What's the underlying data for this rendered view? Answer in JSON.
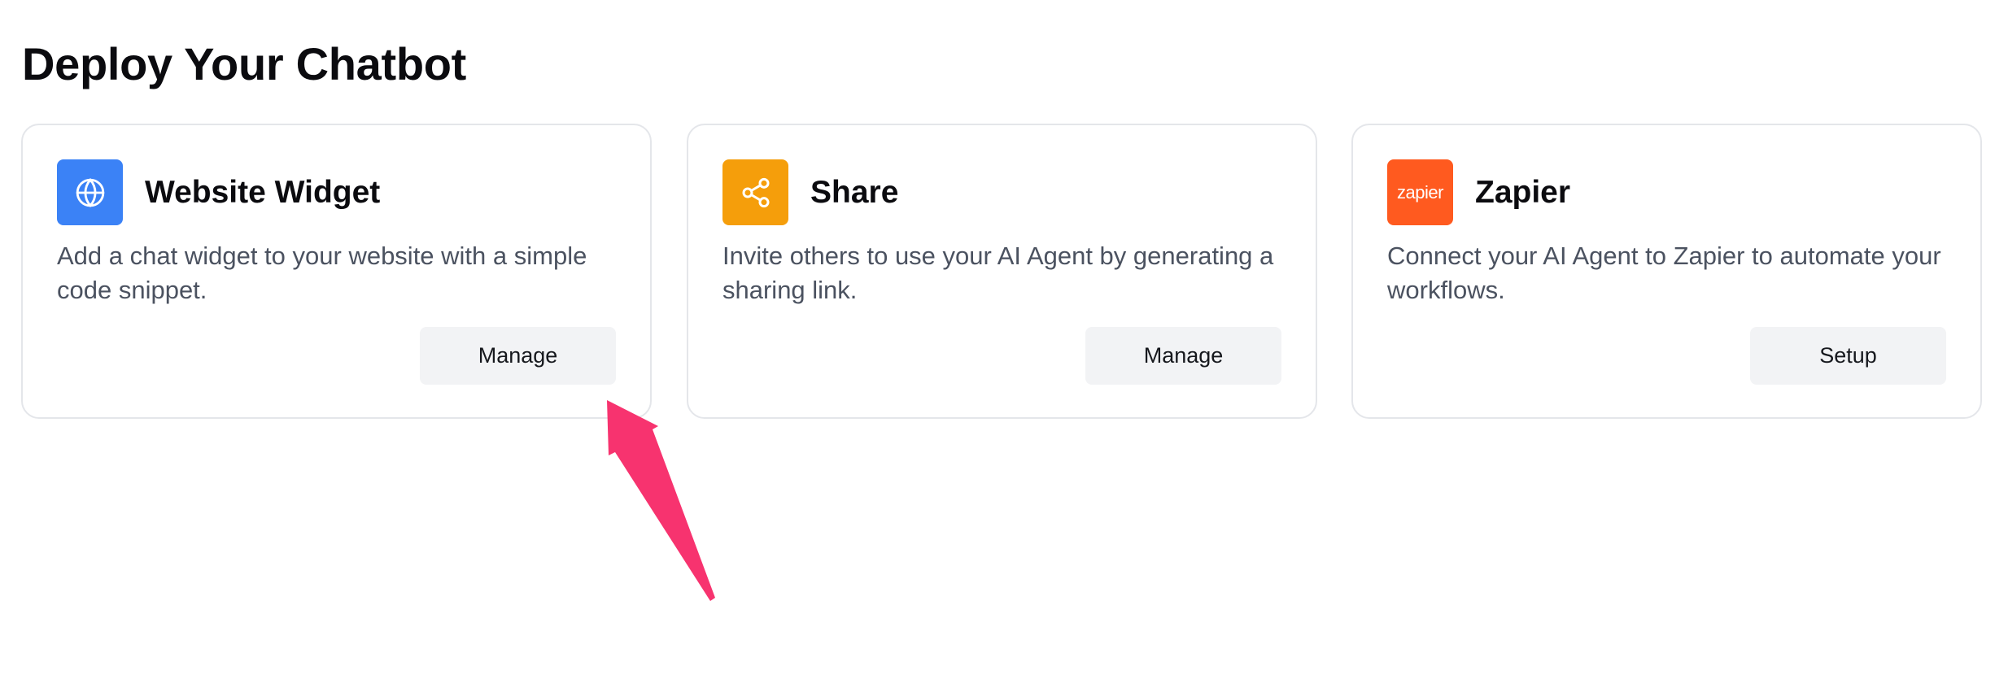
{
  "page_title": "Deploy Your Chatbot",
  "cards": [
    {
      "title": "Website Widget",
      "description": "Add a chat widget to your website with a simple code snippet.",
      "button_label": "Manage",
      "icon": "globe-icon",
      "icon_color": "#3b82f6"
    },
    {
      "title": "Share",
      "description": "Invite others to use your AI Agent by generating a sharing link.",
      "button_label": "Manage",
      "icon": "share-icon",
      "icon_color": "#f59e0b"
    },
    {
      "title": "Zapier",
      "description": "Connect your AI Agent to Zapier to automate your workflows.",
      "button_label": "Setup",
      "icon": "zapier-icon",
      "icon_text": "zapier",
      "icon_color": "#ff5a1f"
    }
  ],
  "annotation": {
    "arrow_color": "#f7336f"
  }
}
